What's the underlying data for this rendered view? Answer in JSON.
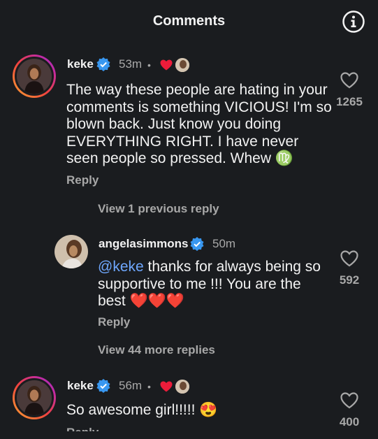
{
  "header": {
    "title": "Comments"
  },
  "comments": [
    {
      "username": "keke",
      "time": "53m",
      "separator": "•",
      "text": "The way these people are hating in your comments is something VICIOUS! I'm so blown back. Just know you doing EVERYTHING RIGHT. I have never seen people so pressed. Whew ♍",
      "reply_label": "Reply",
      "likes": "1265"
    },
    {
      "username": "angelasimmons",
      "time": "50m",
      "mention": "@keke",
      "text": " thanks for always being so supportive to me !!! You are the best ❤️❤️❤️",
      "reply_label": "Reply",
      "likes": "592"
    },
    {
      "username": "keke",
      "time": "56m",
      "separator": "•",
      "text": "So awesome girl!!!!! 😍",
      "reply_label": "Reply",
      "likes": "400"
    }
  ],
  "view_previous": "View 1 previous reply",
  "view_more": "View 44 more replies",
  "colors": {
    "background": "#1a1c1f",
    "verified": "#3897f0",
    "heart": "#ed1c3a",
    "mention": "#6fa8ff",
    "muted": "#a8a8a8"
  }
}
